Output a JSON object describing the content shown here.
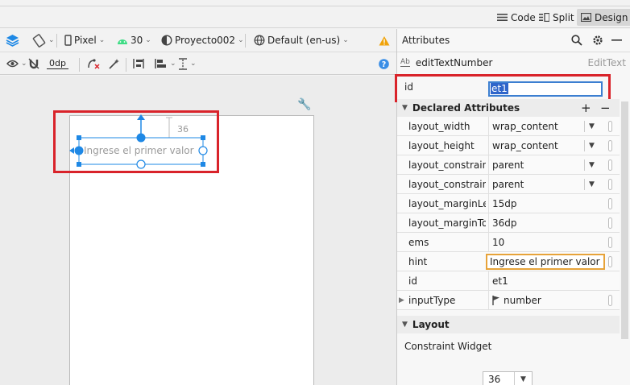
{
  "view_modes": [
    {
      "label": "Code",
      "icon": "lines-icon"
    },
    {
      "label": "Split",
      "icon": "split-icon"
    },
    {
      "label": "Design",
      "icon": "image-icon",
      "active": true
    }
  ],
  "toolbar": {
    "device": "Pixel",
    "api_level": "30",
    "project": "Proyecto002",
    "locale": "Default (en-us)",
    "margin": "0dp"
  },
  "canvas": {
    "hint_text": "Ingrese el primer valor",
    "margin_top_label": "36"
  },
  "attributes": {
    "title": "Attributes",
    "component_name": "editTextNumber",
    "component_type": "EditText",
    "id_label": "id",
    "id_value": "et1",
    "declared_title": "Declared Attributes",
    "rows": [
      {
        "name": "layout_width",
        "value": "wrap_content",
        "dropdown": true
      },
      {
        "name": "layout_height",
        "value": "wrap_content",
        "dropdown": true
      },
      {
        "name": "layout_constrain...",
        "value": "parent",
        "dropdown": true
      },
      {
        "name": "layout_constrain...",
        "value": "parent",
        "dropdown": true
      },
      {
        "name": "layout_marginLeft",
        "value": "15dp"
      },
      {
        "name": "layout_marginTop",
        "value": "36dp"
      },
      {
        "name": "ems",
        "value": "10"
      },
      {
        "name": "hint",
        "value": "Ingrese el primer valor",
        "editing": true
      },
      {
        "name": "id",
        "value": "et1"
      },
      {
        "name": "inputType",
        "value": "number",
        "expandable": true
      }
    ],
    "layout_title": "Layout",
    "constraint_widget_label": "Constraint Widget",
    "constraint_value": "36"
  },
  "colors": {
    "accent_blue": "#1e88e5",
    "highlight_red": "#d9232a",
    "warning": "#f0a30a",
    "android_green": "#3ddc84"
  }
}
